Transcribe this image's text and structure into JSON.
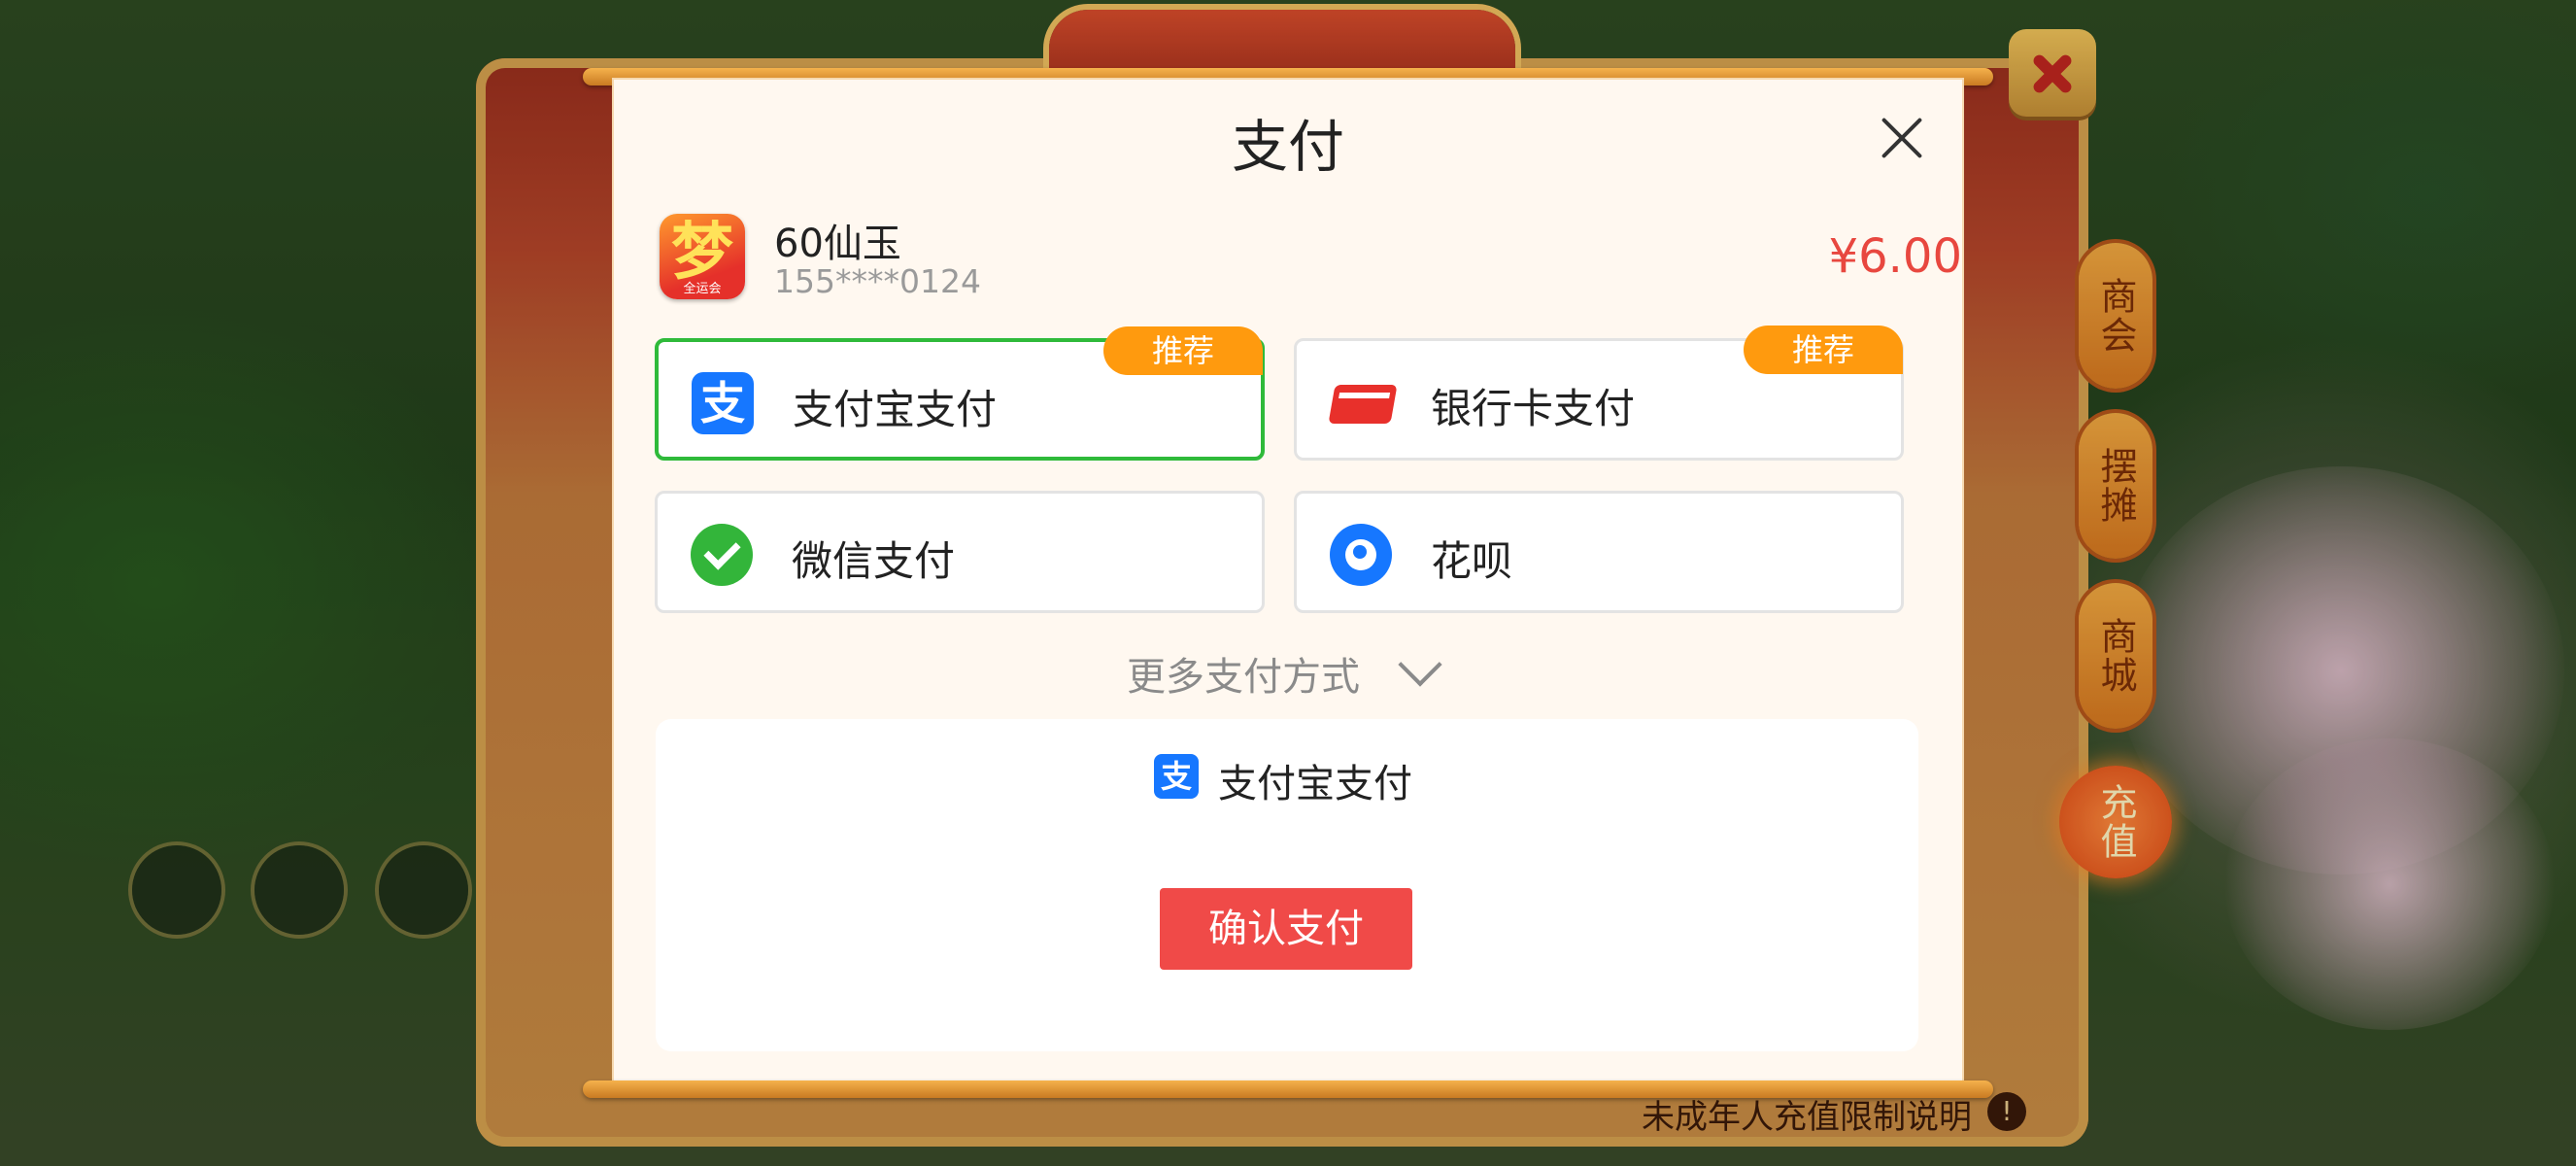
{
  "game_background": {
    "side_tabs": [
      {
        "label": "商会"
      },
      {
        "label": "摆摊"
      },
      {
        "label": "商城"
      },
      {
        "label": "充值"
      }
    ],
    "bottom_note": "未成年人充值限制说明",
    "bottom_note_icon_text": "!"
  },
  "payment_dialog": {
    "title": "支付",
    "product": {
      "icon_glyph": "梦",
      "icon_subtext": "全运会",
      "name": "60仙玉",
      "account": "155****0124",
      "price": "¥6.00"
    },
    "options": [
      {
        "label": "支付宝支付",
        "icon": "alipay-icon",
        "badge": "推荐",
        "selected": true
      },
      {
        "label": "银行卡支付",
        "icon": "bank-card-icon",
        "badge": "推荐",
        "selected": false
      },
      {
        "label": "微信支付",
        "icon": "wechat-pay-icon",
        "badge": "",
        "selected": false
      },
      {
        "label": "花呗",
        "icon": "huabei-icon",
        "badge": "",
        "selected": false
      }
    ],
    "more_methods": "更多支付方式",
    "selected_method": {
      "label": "支付宝支付",
      "icon_glyph": "支"
    },
    "alipay_icon_glyph": "支",
    "confirm_button": "确认支付"
  },
  "colors": {
    "accent_red": "#f04a48",
    "price_red": "#e8473f",
    "selected_green": "#2fba3a",
    "badge_orange": "#ff9a0e",
    "alipay_blue": "#1677ff",
    "wechat_green": "#33b53a"
  }
}
